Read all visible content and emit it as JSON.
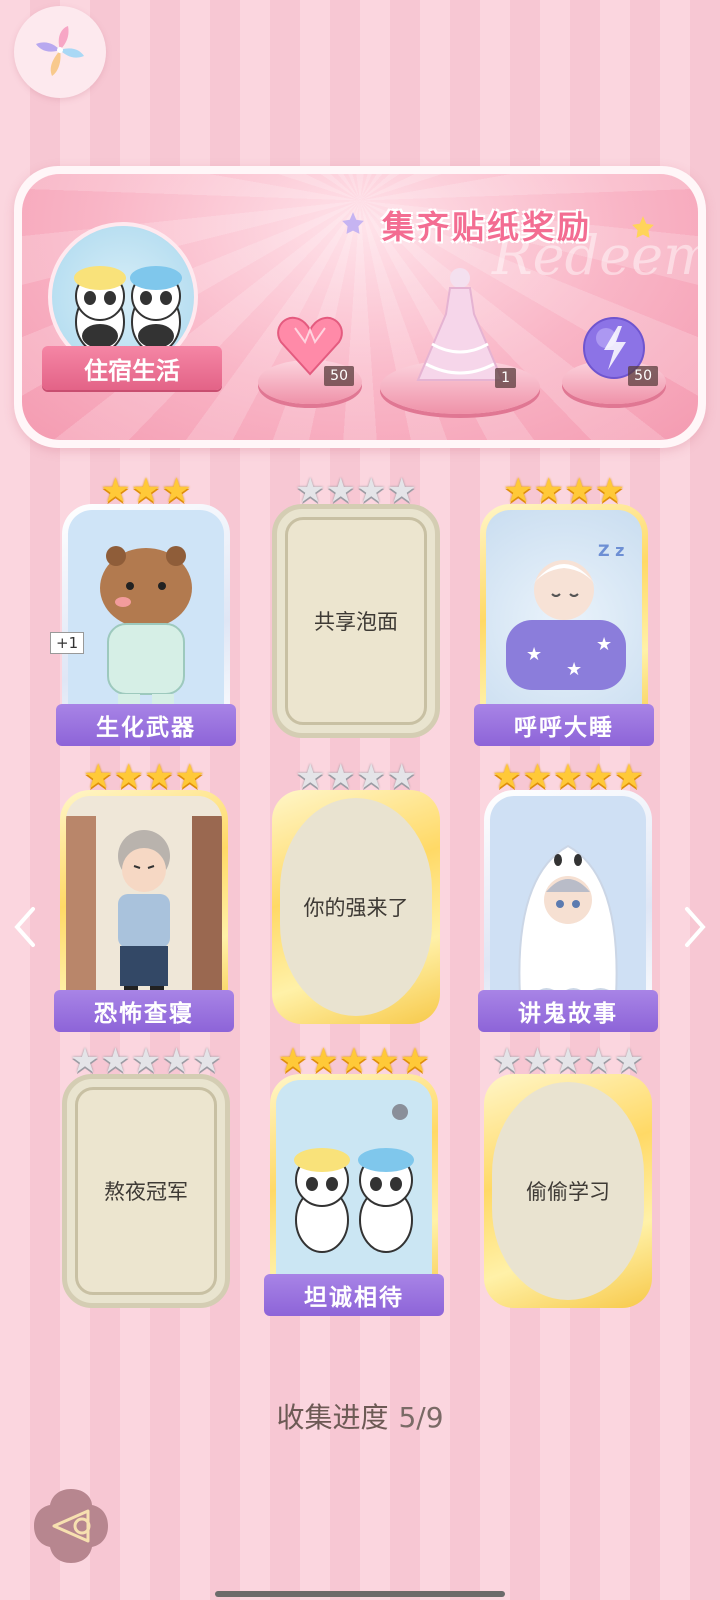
{
  "reward": {
    "title": "集齐贴纸奖励",
    "watermark": "Redeem",
    "theme_name": "住宿生活",
    "items": [
      {
        "name": "heart-gem",
        "count": "50"
      },
      {
        "name": "dress",
        "count": "1"
      },
      {
        "name": "energy-orb",
        "count": "50"
      }
    ]
  },
  "cards": [
    {
      "name": "生化武器",
      "collected": true,
      "stars": 3,
      "extra": "+1"
    },
    {
      "name": "共享泡面",
      "collected": false,
      "stars": 4
    },
    {
      "name": "呼呼大睡",
      "collected": true,
      "stars": 4
    },
    {
      "name": "恐怖查寝",
      "collected": true,
      "stars": 4
    },
    {
      "name": "你的强来了",
      "collected": false,
      "stars": 4
    },
    {
      "name": "讲鬼故事",
      "collected": true,
      "stars": 5
    },
    {
      "name": "熬夜冠军",
      "collected": false,
      "stars": 5
    },
    {
      "name": "坦诚相待",
      "collected": true,
      "stars": 5
    },
    {
      "name": "偷偷学习",
      "collected": false,
      "stars": 5
    }
  ],
  "progress": {
    "label": "收集进度",
    "value": "5/9"
  },
  "colors": {
    "accent_pink": "#f36d92",
    "banner_purple": "#8d64d8",
    "star_gold": "#ffc938"
  }
}
